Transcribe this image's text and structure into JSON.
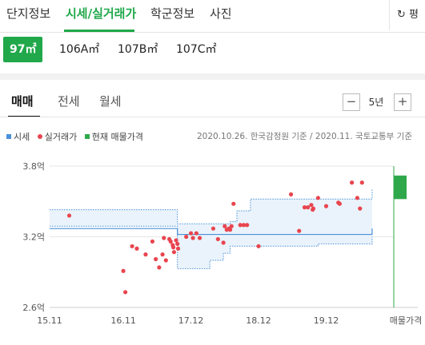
{
  "top_tabs": [
    {
      "label": "단지정보",
      "active": false
    },
    {
      "label": "시세/실거래가",
      "active": true
    },
    {
      "label": "학군정보",
      "active": false
    },
    {
      "label": "사진",
      "active": false
    }
  ],
  "refresh_label": "↻ 평",
  "sizes": [
    {
      "label": "97㎡",
      "active": true
    },
    {
      "label": "106A㎡",
      "active": false
    },
    {
      "label": "107B㎡",
      "active": false
    },
    {
      "label": "107C㎡",
      "active": false
    }
  ],
  "trade_tabs": [
    {
      "label": "매매",
      "active": true
    },
    {
      "label": "전세",
      "active": false
    },
    {
      "label": "월세",
      "active": false
    }
  ],
  "period": {
    "value": "5년",
    "minus": "−",
    "plus": "+"
  },
  "legend": {
    "items": [
      {
        "label": "시세",
        "color": "#4a90d9"
      },
      {
        "label": "실거래가",
        "color": "#e8454f"
      },
      {
        "label": "현재 매물가격",
        "color": "#2ea84a"
      }
    ],
    "source": "2020.10.26. 한국감정원 기준 / 2020.11. 국토교통부 기준"
  },
  "chart_data": {
    "type": "scatter",
    "y_ticks": [
      "3.8억",
      "3.2억",
      "2.6억"
    ],
    "ylim": [
      2.6,
      3.8
    ],
    "x_ticks": [
      "15.11",
      "16.11",
      "17.12",
      "18.12",
      "19.12",
      "매물가격"
    ],
    "xlim": [
      2015.83,
      2020.92
    ],
    "series": [
      {
        "name": "실거래가",
        "color": "#e8454f",
        "x": [
          2016.12,
          2016.92,
          2016.95,
          2017.05,
          2017.12,
          2017.25,
          2017.35,
          2017.4,
          2017.45,
          2017.5,
          2017.52,
          2017.55,
          2017.6,
          2017.62,
          2017.65,
          2017.66,
          2017.67,
          2017.7,
          2017.72,
          2017.73,
          2017.85,
          2017.92,
          2017.95,
          2018.0,
          2018.05,
          2018.25,
          2018.32,
          2018.4,
          2018.42,
          2018.45,
          2018.48,
          2018.5,
          2018.52,
          2018.55,
          2018.65,
          2018.7,
          2018.75,
          2018.92,
          2019.4,
          2019.52,
          2019.6,
          2019.65,
          2019.7,
          2019.72,
          2019.73,
          2019.8,
          2019.92,
          2020.1,
          2020.12,
          2020.3,
          2020.38,
          2020.42,
          2020.45
        ],
        "y": [
          3.38,
          2.91,
          2.73,
          3.12,
          3.1,
          3.05,
          3.16,
          3.01,
          2.94,
          3.05,
          3.19,
          3.0,
          3.18,
          3.16,
          3.13,
          3.11,
          3.07,
          3.17,
          3.14,
          3.1,
          3.2,
          3.23,
          3.19,
          3.23,
          3.19,
          3.27,
          3.18,
          3.15,
          3.29,
          3.26,
          3.27,
          3.26,
          3.29,
          3.48,
          3.3,
          3.3,
          3.3,
          3.12,
          3.56,
          3.25,
          3.45,
          3.45,
          3.47,
          3.43,
          3.44,
          3.53,
          3.46,
          3.49,
          3.48,
          3.66,
          3.53,
          3.44,
          3.66
        ]
      },
      {
        "name": "시세",
        "color": "#4a90d9",
        "x": [
          2015.83,
          2016.0,
          2016.5,
          2016.9,
          2017.0,
          2017.5,
          2017.7,
          2017.72,
          2017.8,
          2018.2,
          2018.4,
          2018.5,
          2018.6,
          2018.8,
          2019.0,
          2019.5,
          2019.8,
          2020.0,
          2020.3,
          2020.5,
          2020.6
        ],
        "y": [
          3.27,
          3.27,
          3.27,
          3.27,
          3.27,
          3.27,
          3.27,
          3.22,
          3.22,
          3.22,
          3.22,
          3.22,
          3.22,
          3.22,
          3.22,
          3.22,
          3.22,
          3.22,
          3.22,
          3.22,
          3.27
        ]
      }
    ],
    "band_upper": {
      "x": [
        2015.83,
        2016.5,
        2017.5,
        2017.7,
        2017.72,
        2018.0,
        2018.2,
        2018.4,
        2018.5,
        2018.6,
        2018.8,
        2019.0,
        2019.5,
        2019.8,
        2020.0,
        2020.3,
        2020.55,
        2020.6
      ],
      "y": [
        3.43,
        3.43,
        3.43,
        3.43,
        3.31,
        3.31,
        3.31,
        3.31,
        3.33,
        3.42,
        3.52,
        3.52,
        3.52,
        3.52,
        3.52,
        3.52,
        3.52,
        3.61
      ]
    },
    "band_lower": {
      "x": [
        2015.83,
        2016.5,
        2017.5,
        2017.7,
        2017.72,
        2018.0,
        2018.2,
        2018.4,
        2018.5,
        2018.6,
        2018.8,
        2019.0,
        2019.5,
        2019.8,
        2020.0,
        2020.3,
        2020.55,
        2020.6
      ],
      "y": [
        3.29,
        3.29,
        3.29,
        3.29,
        2.93,
        2.93,
        3.0,
        3.06,
        3.12,
        3.12,
        3.12,
        3.12,
        3.12,
        3.14,
        3.14,
        3.14,
        3.14,
        3.2
      ]
    },
    "current_listing": {
      "color": "#2ea84a",
      "low": 3.52,
      "high": 3.72
    }
  }
}
